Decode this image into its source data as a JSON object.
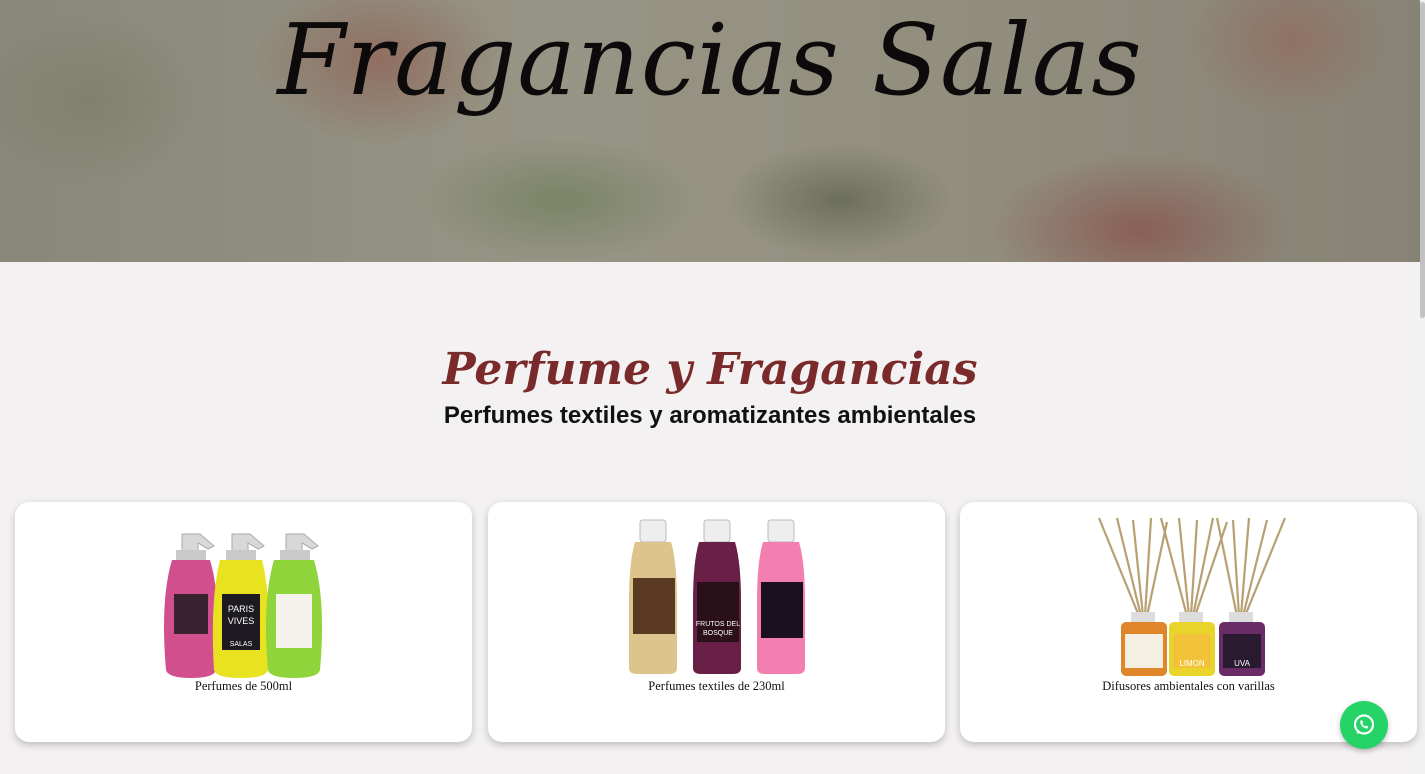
{
  "hero": {
    "title": "Fragancias Salas"
  },
  "section": {
    "title": "Perfume y Fragancias",
    "subtitle": "Perfumes textiles y aromatizantes ambientales"
  },
  "products": [
    {
      "label": "Perfumes de 500ml",
      "bottle_labels": [
        "PARIS",
        "VIVES",
        "SALAS"
      ],
      "colors": [
        "#d24f8e",
        "#e8e21f",
        "#8fd43a"
      ]
    },
    {
      "label": "Perfumes textiles de 230ml",
      "bottle_labels": [
        "FRUTOS DEL",
        "BOSQUE"
      ],
      "colors": [
        "#dcc48c",
        "#6a1f46",
        "#f27fb0"
      ]
    },
    {
      "label": "Difusores ambientales con varillas",
      "bottle_labels": [
        "LIMON",
        "UVA"
      ],
      "colors": [
        "#e0862a",
        "#e8d42a",
        "#6a2c66"
      ]
    }
  ],
  "floating": {
    "icon": "whatsapp-icon",
    "color": "#25d366"
  }
}
